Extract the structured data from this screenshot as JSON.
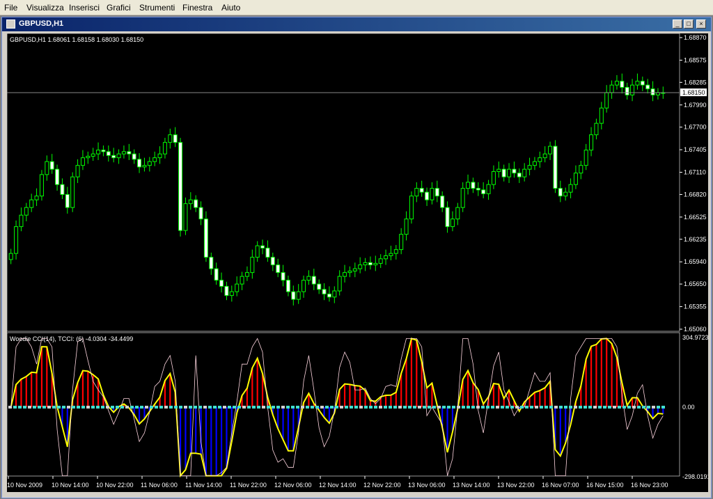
{
  "menu": [
    "File",
    "Visualizza",
    "Inserisci",
    "Grafici",
    "Strumenti",
    "Finestra",
    "Aiuto"
  ],
  "window": {
    "title": "GBPUSD,H1",
    "min": "_",
    "max": "□",
    "close": "×"
  },
  "price_info": "GBPUSD,H1  1.68061  1.68158  1.68030  1.68150",
  "price_axis": [
    "1.68870",
    "1.68575",
    "1.68285",
    "1.67990",
    "1.67700",
    "1.67405",
    "1.67110",
    "1.66820",
    "1.66525",
    "1.66235",
    "1.65940",
    "1.65650",
    "1.65355",
    "1.65060"
  ],
  "current_price_label": "1.68150",
  "indicator_info": "Woodie CCI(14), TCCI: (6) -4.0304 -34.4499",
  "indicator_axis": {
    "max": "304.9723",
    "zero": "0.00",
    "min": "-298.0191"
  },
  "time_axis": [
    "10 Nov 2009",
    "10 Nov 14:00",
    "10 Nov 22:00",
    "11 Nov 06:00",
    "11 Nov 14:00",
    "11 Nov 22:00",
    "12 Nov 06:00",
    "12 Nov 14:00",
    "12 Nov 22:00",
    "13 Nov 06:00",
    "13 Nov 14:00",
    "13 Nov 22:00",
    "16 Nov 07:00",
    "16 Nov 15:00",
    "16 Nov 23:00"
  ],
  "colors": {
    "bull": "#00ff00",
    "bear_fill": "#ffffff",
    "grid": "#888888",
    "cci_pos": "#ff0000",
    "cci_neg": "#0000ff",
    "cci_line": "#ffff00",
    "tcci_line": "#ffffff",
    "zero_dots": "#40e0d0"
  },
  "chart_data": {
    "type": "candlestick",
    "symbol": "GBPUSD",
    "timeframe": "H1",
    "ylim": [
      1.6506,
      1.6887
    ],
    "close": [
      1.6605,
      1.664,
      1.6655,
      1.6665,
      1.6675,
      1.668,
      1.6708,
      1.6725,
      1.6715,
      1.6695,
      1.6682,
      1.6665,
      1.6705,
      1.672,
      1.673,
      1.6732,
      1.6735,
      1.674,
      1.6738,
      1.6733,
      1.673,
      1.6735,
      1.6738,
      1.6735,
      1.6728,
      1.6718,
      1.672,
      1.6725,
      1.673,
      1.6735,
      1.675,
      1.676,
      1.675,
      1.6635,
      1.667,
      1.6675,
      1.6665,
      1.665,
      1.66,
      1.6585,
      1.657,
      1.6562,
      1.655,
      1.6555,
      1.6565,
      1.6575,
      1.658,
      1.66,
      1.6615,
      1.6612,
      1.66,
      1.659,
      1.658,
      1.657,
      1.6555,
      1.6545,
      1.6555,
      1.657,
      1.6575,
      1.6565,
      1.6558,
      1.6552,
      1.6548,
      1.6556,
      1.6575,
      1.658,
      1.6582,
      1.6585,
      1.659,
      1.6593,
      1.659,
      1.6592,
      1.6598,
      1.6602,
      1.6605,
      1.661,
      1.663,
      1.665,
      1.668,
      1.669,
      1.6685,
      1.6675,
      1.669,
      1.668,
      1.6665,
      1.664,
      1.665,
      1.6665,
      1.669,
      1.6698,
      1.669,
      1.6688,
      1.6683,
      1.6695,
      1.6712,
      1.6715,
      1.6705,
      1.6715,
      1.671,
      1.6705,
      1.6715,
      1.672,
      1.6725,
      1.673,
      1.6735,
      1.6745,
      1.669,
      1.668,
      1.6685,
      1.6695,
      1.671,
      1.672,
      1.674,
      1.676,
      1.6775,
      1.6795,
      1.6815,
      1.6825,
      1.683,
      1.6822,
      1.6812,
      1.6825,
      1.683,
      1.6825,
      1.682,
      1.6812,
      1.6815,
      1.6815
    ]
  }
}
